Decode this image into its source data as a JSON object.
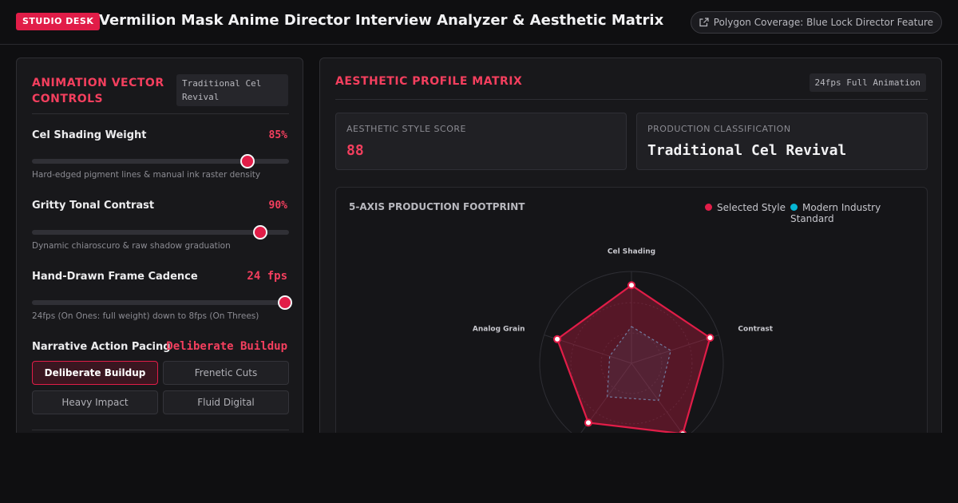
{
  "header": {
    "badge": "STUDIO DESK",
    "title": "Vermilion Mask Anime Director Interview Analyzer & Aesthetic Matrix",
    "coverage_label": "Polygon Coverage: Blue Lock Director Feature",
    "coverage_icon": "external-link-icon"
  },
  "controls": {
    "title_line1": "ANIMATION VECTOR",
    "title_line2": "CONTROLS",
    "mode_tag_line1": "Traditional Cel",
    "mode_tag_line2": "Revival",
    "cel_shading": {
      "label": "Cel Shading Weight",
      "value": "85%",
      "level": 0.85,
      "hint": "Hard-edged pigment lines & manual ink raster density"
    },
    "tonal_contrast": {
      "label": "Gritty Tonal Contrast",
      "value": "90%",
      "level": 0.9,
      "hint": "Dynamic chiaroscuro & raw shadow graduation"
    },
    "frame_cadence": {
      "label": "Hand-Drawn Frame Cadence",
      "value": "24 fps",
      "level": 1.0,
      "hint": "24fps (On Ones: full weight) down to 8fps (On Threes)"
    },
    "pacing": {
      "label": "Narrative Action Pacing",
      "value": "Deliberate Buildup",
      "options": [
        "Deliberate Buildup",
        "Frenetic Cuts",
        "Heavy Impact",
        "Fluid Digital"
      ],
      "selected": "Deliberate Buildup"
    }
  },
  "matrix": {
    "title": "AESTHETIC PROFILE MATRIX",
    "tag": "24fps Full Animation",
    "score_label": "AESTHETIC STYLE SCORE",
    "score_value": "88",
    "class_label": "PRODUCTION CLASSIFICATION",
    "class_value": "Traditional Cel Revival"
  },
  "chart_data": {
    "type": "radar",
    "title": "5-AXIS PRODUCTION FOOTPRINT",
    "axes": [
      "Cel Shading",
      "Contrast",
      "",
      "",
      "Analog Grain"
    ],
    "series": [
      {
        "name": "Selected Style",
        "values": [
          0.85,
          0.9,
          0.95,
          0.8,
          0.85
        ]
      },
      {
        "name": "Modern Industry Standard",
        "values": [
          0.4,
          0.45,
          0.5,
          0.45,
          0.25
        ]
      }
    ],
    "range": [
      0,
      1
    ],
    "colors": {
      "selected": "#e11d48",
      "standard": "#06b6d4"
    },
    "legend_position": "top-right"
  }
}
